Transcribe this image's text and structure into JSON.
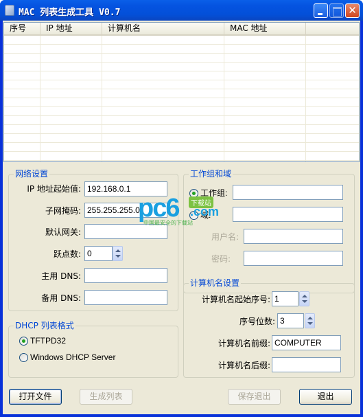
{
  "window": {
    "title": "MAC 列表生成工具 V0.7",
    "minimize_icon": "minimize-icon",
    "maximize_icon": "maximize-icon",
    "close_icon": "close-icon",
    "close_glyph": "✕"
  },
  "list": {
    "columns": [
      "序号",
      "IP 地址",
      "计算机名",
      "MAC 地址",
      ""
    ],
    "rows": []
  },
  "network": {
    "title": "网络设置",
    "ip_start_label": "IP 地址起始值:",
    "ip_start_value": "192.168.0.1",
    "subnet_label": "子网掩码:",
    "subnet_value": "255.255.255.0",
    "gateway_label": "默认网关:",
    "gateway_value": "",
    "hops_label": "跃点数:",
    "hops_value": "0",
    "dns1_label": "主用 DNS:",
    "dns1_value": "",
    "dns2_label": "备用 DNS:",
    "dns2_value": ""
  },
  "dhcp": {
    "title": "DHCP 列表格式",
    "options": [
      {
        "label": "TFTPD32",
        "selected": true
      },
      {
        "label": "Windows DHCP Server",
        "selected": false
      }
    ]
  },
  "workgroup": {
    "title": "工作组和域",
    "workgroup_label": "工作组:",
    "workgroup_selected": true,
    "workgroup_value": "",
    "domain_label": "域:",
    "domain_value": "",
    "username_label": "用户名:",
    "username_value": "",
    "password_label": "密码:",
    "password_value": ""
  },
  "computer": {
    "title": "计算机名设置",
    "start_label": "计算机名起始序号:",
    "start_value": "1",
    "digits_label": "序号位数:",
    "digits_value": "3",
    "prefix_label": "计算机名前缀:",
    "prefix_value": "COMPUTER",
    "suffix_label": "计算机名后缀:",
    "suffix_value": ""
  },
  "buttons": {
    "open_file": "打开文件",
    "generate": "生成列表",
    "save_exit": "保存退出",
    "exit": "退出"
  },
  "watermark": {
    "brand": "pc6",
    "badge": "下载站",
    "domain": ".com",
    "tagline": "中国最安全的下载站"
  }
}
